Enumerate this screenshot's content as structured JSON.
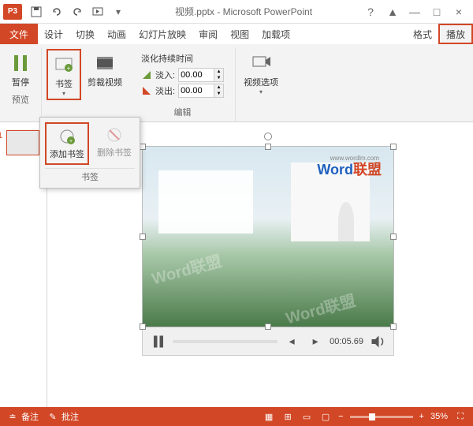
{
  "app": {
    "icon_label": "P3",
    "title": "视频.pptx - Microsoft PowerPoint"
  },
  "qat": [
    "save",
    "undo",
    "redo",
    "start",
    "touch"
  ],
  "window": {
    "help": "?",
    "ribbon_opts": "▲",
    "min": "—",
    "max": "□",
    "close": "×"
  },
  "tabs": {
    "file": "文件",
    "list": [
      "设计",
      "切换",
      "动画",
      "幻灯片放映",
      "审阅",
      "视图",
      "加载项"
    ],
    "contextual": [
      "格式",
      "播放"
    ],
    "active": "播放"
  },
  "ribbon": {
    "preview": {
      "label": "暂停",
      "group": "预览"
    },
    "bookmark": {
      "label": "书签",
      "add": "添加书签",
      "remove": "删除书签",
      "group": "书签"
    },
    "trim": {
      "label": "剪裁视频"
    },
    "fade": {
      "title": "淡化持续时间",
      "in_label": "淡入:",
      "out_label": "淡出:",
      "in_val": "00.00",
      "out_val": "00.00",
      "group": "编辑"
    },
    "video_options": {
      "label": "视频选项"
    }
  },
  "slide": {
    "number": "1"
  },
  "brand": {
    "word": "Word",
    "cn": "联盟",
    "url": "www.wordlm.com"
  },
  "player": {
    "time": "00:05.69"
  },
  "statusbar": {
    "notes": "备注",
    "comments": "批注",
    "zoom": "35%",
    "zoom_minus": "−",
    "zoom_plus": "+"
  }
}
